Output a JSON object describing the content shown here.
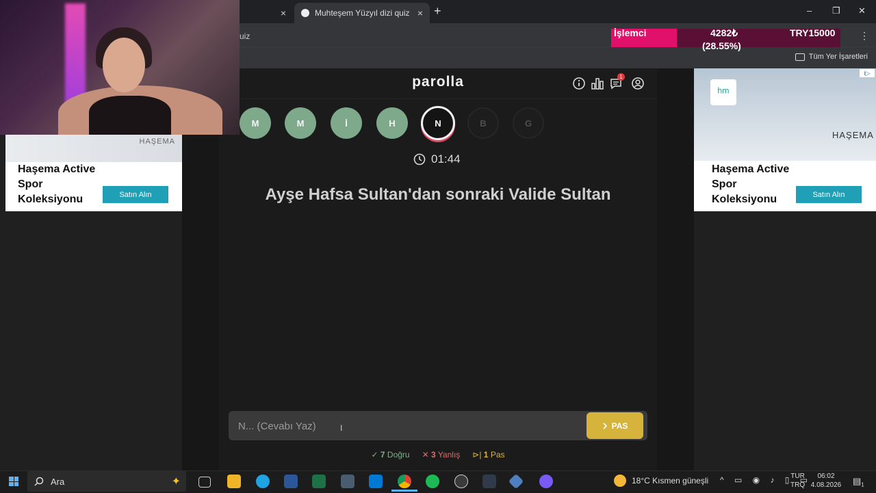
{
  "browser": {
    "tabs": [
      {
        "label": "",
        "close": "×"
      },
      {
        "label": "Muhteşem Yüzyıl dizi quiz quiz",
        "close": "×"
      }
    ],
    "new_tab": "+",
    "window_controls": [
      "–",
      "❐",
      "✕"
    ],
    "url_fragment": "uiz",
    "bookmarks_label": "Tüm Yer İşaretleri",
    "menu": "⋮"
  },
  "stream_overlay": {
    "label": "İşlemci",
    "price": "4282₺",
    "percent": "(28.55%)",
    "goal": "TRY15000",
    "progress": 0.2855
  },
  "app": {
    "logo": "parolla",
    "notification_count": "1",
    "letters": [
      {
        "char": "M",
        "state": "done"
      },
      {
        "char": "M",
        "state": "done"
      },
      {
        "char": "İ",
        "state": "done"
      },
      {
        "char": "H",
        "state": "done"
      },
      {
        "char": "N",
        "state": "current"
      },
      {
        "char": "B",
        "state": "pending"
      },
      {
        "char": "G",
        "state": "pending"
      }
    ],
    "timer": "01:44",
    "question": "Ayşe Hafsa Sultan'dan sonraki Valide Sultan",
    "answer_placeholder": "N... (Cevabı Yaz)",
    "pass_label": "PAS",
    "score": {
      "correct_count": "7",
      "correct_label": "Doğru",
      "wrong_count": "3",
      "wrong_label": "Yanlış",
      "pass_count": "1",
      "pass_label": "Pas"
    }
  },
  "ads": {
    "left": {
      "brand": "HAŞEMA",
      "text": "Haşema Active Spor Koleksiyonu",
      "button": "Satın Alın"
    },
    "right": {
      "brand": "HAŞEMA",
      "text": "Haşema Active Spor Koleksiyonu",
      "button": "Satın Alın",
      "adchoice": "i▷"
    }
  },
  "taskbar": {
    "search_label": "Ara",
    "weather": "18°C  Kısmen güneşli",
    "lang_top": "TUR",
    "lang_bottom": "TRQ",
    "time": "06:02",
    "date": "4.08.2026",
    "notif_count": "1"
  },
  "colors": {
    "correct": "#7ea98a",
    "current_ring": "#e04a66",
    "pass_button": "#d6b43c",
    "overlay_fill": "#e0106b"
  }
}
